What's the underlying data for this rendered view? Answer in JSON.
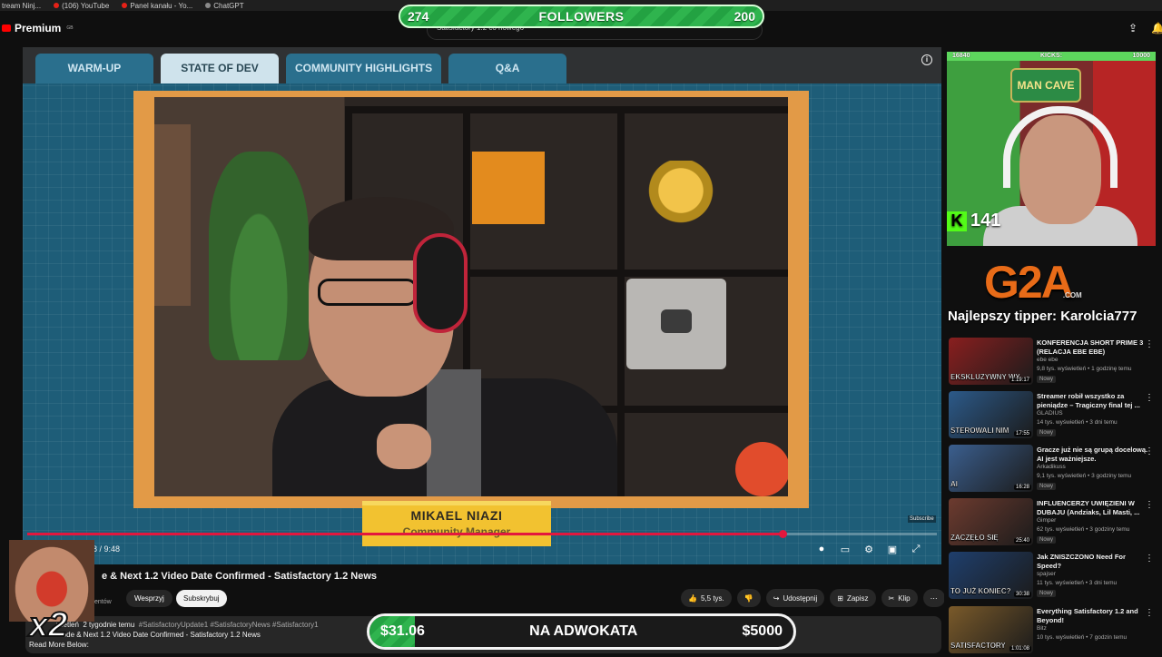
{
  "bookmarks": [
    "tream Ninj...",
    "(106) YouTube",
    "Panel kanału - Yo...",
    "ChatGPT"
  ],
  "header": {
    "logo": "Premium",
    "logo_region": "GB",
    "search_text": "Satisfactory 1.2 co nowego"
  },
  "followers_goal": {
    "current": "274",
    "title": "FOLLOWERS",
    "target": "200",
    "progress": 1.0,
    "color": "#2fb44e"
  },
  "video": {
    "tabs": [
      {
        "label": "WARM-UP",
        "active": false
      },
      {
        "label": "STATE OF DEV",
        "active": true
      },
      {
        "label": "COMMUNITY HIGHLIGHTS",
        "active": false
      },
      {
        "label": "Q&A",
        "active": false
      }
    ],
    "name": "MIKAEL NIAZI",
    "role": "Community Manager",
    "time": "08 / 9:48",
    "progress": 0.83,
    "watermark": "Subscribe",
    "accent": "#e3173e"
  },
  "below": {
    "title": "e & Next 1.2 Video Date Confirmed - Satisfactory 1.2 News",
    "channel_sub": "entów",
    "support_label": "Wesprzyj",
    "subscribe_label": "Subskrybuj",
    "actions": {
      "like": "5,5 tys.",
      "share": "Udostępnij",
      "save": "Zapisz",
      "clip": "Klip"
    },
    "desc_views": "wietleń",
    "desc_age": "2 tygodnie temu",
    "desc_tags": "#SatisfactoryUpdate1 #SatisfactoryNews #Satisfactory1",
    "desc_line2": "Mode & Next 1.2 Video Date Confirmed - Satisfactory 1.2 News",
    "desc_line3": "Read More Below:"
  },
  "emote": {
    "multiplier": "x2"
  },
  "donation_goal": {
    "current": "$31.06",
    "title": "NA ADWOKATA",
    "target": "$5000",
    "progress": 0.0062
  },
  "webcam": {
    "left_count": "16840",
    "kicks_label": "KICKS:",
    "right_count": "10000",
    "sign": "MAN CAVE",
    "kick_count": "141"
  },
  "sponsor": {
    "brand": "G2A",
    "brand_sub": ".COM",
    "tipper": "Najlepszy tipper: Karolcia777"
  },
  "recommendations": [
    {
      "title": "KONFERENCJA SHORT PRIME 3 (RELACJA EBE EBE)",
      "channel": "ebe ebe",
      "meta": "9,8 tys. wyświetleń • 1 godzinę temu",
      "badge": "Nowy",
      "duration": "1:19:17",
      "caption": "EKSKLUZYWNY WY",
      "color": "#8a1f1f"
    },
    {
      "title": "Streamer robił wszystko za pieniądze – Tragiczny final tej ...",
      "channel": "GLADIUS",
      "meta": "14 tys. wyświetleń • 3 dni temu",
      "badge": "Nowy",
      "duration": "17:55",
      "caption": "STEROWALI NIM",
      "color": "#2c5a8a"
    },
    {
      "title": "Gracze już nie są grupą docelową. AI jest ważniejsze.",
      "channel": "Arkadikuss",
      "meta": "9,1 tys. wyświetleń • 3 godziny temu",
      "badge": "Nowy",
      "duration": "16:28",
      "caption": "AI",
      "color": "#3b5f8f"
    },
    {
      "title": "INFLUENCERZY UWIĘZIENI W DUBAJU (Andziaks, Lil Masti, ...",
      "channel": "Gimper",
      "meta": "62 tys. wyświetleń • 3 godziny temu",
      "badge": "Nowy",
      "duration": "25:40",
      "caption": "ZACZĘŁO SIĘ",
      "color": "#6d3b2f"
    },
    {
      "title": "Jak ZNISZCZONO Need For Speed?",
      "channel": "spajser",
      "meta": "11 tys. wyświetleń • 3 dni temu",
      "badge": "Nowy",
      "duration": "30:38",
      "caption": "TO JUŻ KONIEC?",
      "color": "#1f3f6d"
    },
    {
      "title": "Everything Satisfactory 1.2 and Beyond!",
      "channel": "Bitz",
      "meta": "10 tys. wyświetleń • 7 godzin temu",
      "badge": "",
      "duration": "1:01:08",
      "caption": "SATISFACTORY",
      "color": "#7a5a2a"
    }
  ]
}
